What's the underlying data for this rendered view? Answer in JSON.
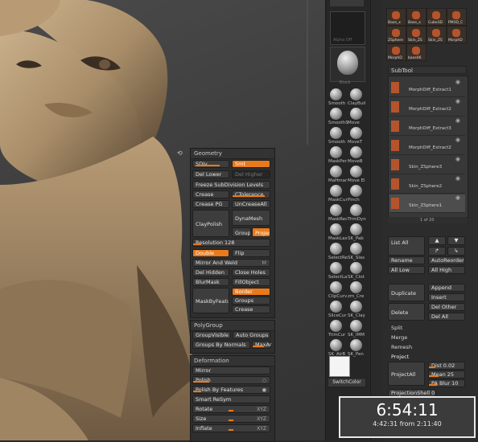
{
  "brushes": [
    {
      "label": "Smooth",
      "label2": "ClayBuil"
    },
    {
      "label": "SmoothS",
      "label2": "Move"
    },
    {
      "label": "Smooth",
      "label2": "MoveT"
    },
    {
      "label": "MaskPer",
      "label2": "MoveB"
    },
    {
      "label": "MaHmar",
      "label2": "Move El"
    },
    {
      "label": "MaskCur",
      "label2": "Pinch"
    },
    {
      "label": "MaskRec",
      "label2": "TrimDyn"
    },
    {
      "label": "MaskLas",
      "label2": "SK_Pab"
    },
    {
      "label": "SelectRe",
      "label2": "SK_Slas"
    },
    {
      "label": "SelectLa",
      "label2": "SK_Clot"
    },
    {
      "label": "ClipCurv",
      "label2": "zm_Cre"
    },
    {
      "label": "SliceCur",
      "label2": "SK_Clay"
    },
    {
      "label": "TrimCur",
      "label2": "SK_IMM"
    },
    {
      "label": "SK_AirB",
      "label2": "SK_Pen"
    }
  ],
  "left_column": {
    "block_label": "Block",
    "alpha_label": "Alpha Off",
    "switch_color": "SwitchColor"
  },
  "geometry": {
    "title": "Geometry",
    "sdiv_label": "SDiv",
    "smt_label": "Smt",
    "del_lower": "Del Lower",
    "del_higher": "Del Higher",
    "freeze": "Freeze SubDivision Levels",
    "crease": "Crease",
    "ctolerance": "CTolerance",
    "crease_pg": "Crease PG",
    "uncrease_all": "UnCreaseAll",
    "claypolish": "ClayPolish",
    "dynamesh": "DynaMesh",
    "groups": "Groups",
    "projec": "Projec",
    "resolution": "Resolution 128",
    "double": "Double",
    "flip": "Flip",
    "mirror_weld": "Mirror And Weld",
    "mirror_weld_key": "M",
    "del_hidden": "Del Hidden",
    "close_holes": "Close Holes",
    "blur_mask": "BlurMask",
    "fill_object": "FillObject",
    "border": "Border",
    "mask_by_feat": "MaskByFeatu",
    "groups2": "Groups",
    "crease2": "Crease"
  },
  "polygroup": {
    "title": "PolyGroup",
    "group_visible": "GroupVisible",
    "auto_groups": "Auto Groups",
    "group_by_normals": "Groups By Normals",
    "max_ar": "MaxAr"
  },
  "deformation": {
    "title": "Deformation",
    "mirror": "Mirror",
    "polish": "Polish",
    "polish_features": "Polish By Features",
    "smart_resym": "Smart ReSym",
    "rotate": "Rotate",
    "size": "Size",
    "inflate": "Inflate",
    "xyz": "XYZ"
  },
  "tools": {
    "items": [
      "Base_x",
      "Base_x",
      "Cube3D",
      "PM3D_C",
      "ZSphere",
      "Skin_ZS",
      "Skin_ZS",
      "MorphD",
      "MorphD",
      "base06"
    ]
  },
  "subtool": {
    "title": "SubTool",
    "items": [
      "MorphDiff_Extract1",
      "MorphDiff_Extract2",
      "MorphDiff_Extract3",
      "MorphDiff_Extract2",
      "Skin_ZSphere3",
      "Skin_ZSphere2",
      "Skin_ZSphere1"
    ],
    "scroll_label": "1 of 20",
    "list_all": "List All",
    "rename": "Rename",
    "auto_reorder": "AutoReorder",
    "all_low": "All Low",
    "all_high": "All High",
    "duplicate": "Duplicate",
    "append": "Append",
    "insert": "Insert",
    "delete": "Delete",
    "del_other": "Del Other",
    "del_all": "Del All",
    "split": "Split",
    "merge": "Merge",
    "remesh": "Remesh",
    "project": "Project",
    "dist": "Dist 0.02",
    "mean": "Mean 25",
    "project_all": "ProjectAll",
    "pa_blur": "PA Blur 10",
    "project_shell": "ProjectionShell 0"
  },
  "clock": {
    "time": "6:54:11",
    "elapsed": "4:42:31",
    "from_label": "from",
    "from_time": "2:11:40"
  },
  "colors": {
    "accent": "#e87a1c",
    "panel": "#2e2e2e",
    "button": "#3d3d3d"
  }
}
